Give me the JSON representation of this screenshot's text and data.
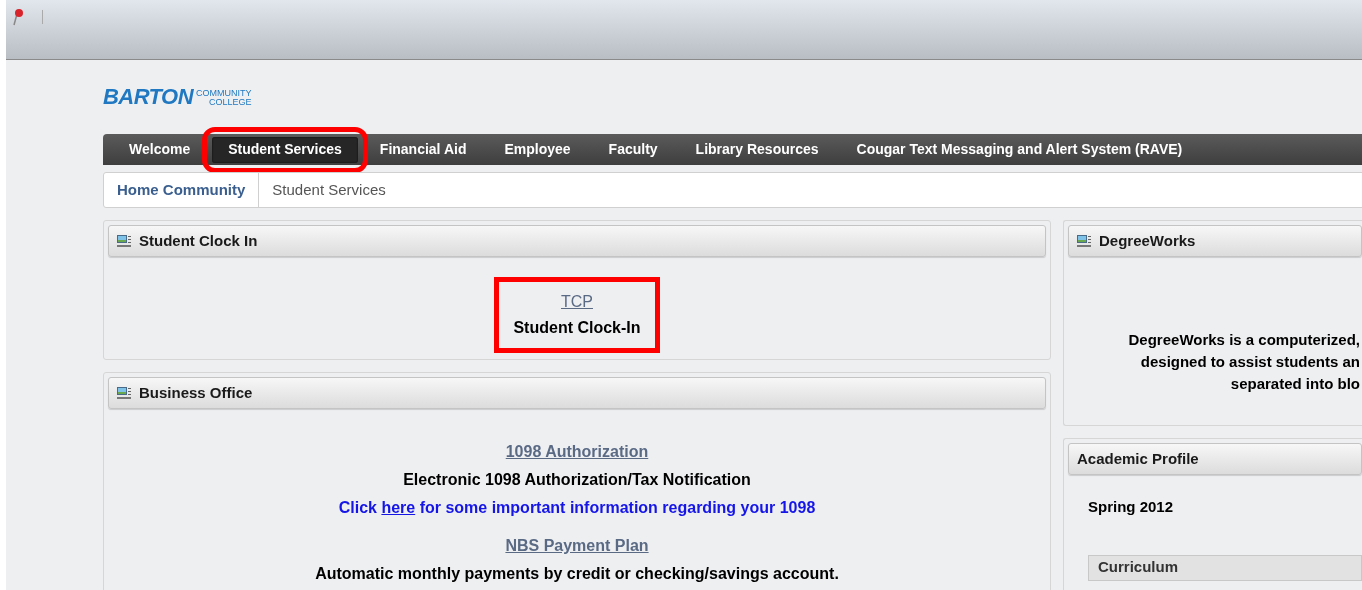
{
  "logo": {
    "name": "BARTON",
    "line_1": "COMMUNITY",
    "line_2": "COLLEGE"
  },
  "nav": [
    {
      "label": "Welcome",
      "selected": false,
      "highlighted": false
    },
    {
      "label": "Student Services",
      "selected": true,
      "highlighted": true
    },
    {
      "label": "Financial Aid",
      "selected": false,
      "highlighted": false
    },
    {
      "label": "Employee",
      "selected": false,
      "highlighted": false
    },
    {
      "label": "Faculty",
      "selected": false,
      "highlighted": false
    },
    {
      "label": "Library Resources",
      "selected": false,
      "highlighted": false
    },
    {
      "label": "Cougar Text Messaging and Alert System (RAVE)",
      "selected": false,
      "highlighted": false
    }
  ],
  "breadcrumb": [
    "Home Community",
    "Student Services"
  ],
  "student_clock_in": {
    "title": "Student Clock In",
    "link": "TCP",
    "caption": "Student Clock-In",
    "highlighted": true
  },
  "business_office": {
    "title": "Business Office",
    "items": [
      {
        "link": "1098 Authorization",
        "caption": "Electronic 1098 Authorization/Tax Notification",
        "note": {
          "before": "Click",
          "link": "here",
          "after": "for some important information regarding your 1098"
        }
      },
      {
        "link": "NBS Payment Plan",
        "caption": "Automatic monthly payments by credit or checking/savings account."
      }
    ]
  },
  "degreeworks": {
    "title": "DegreeWorks",
    "lines": [
      "DegreeWorks is a computerized,",
      "designed to assist students an",
      "separated into blo"
    ]
  },
  "academic_profile": {
    "title": "Academic Profile",
    "term": "Spring 2012",
    "table_header": "Curriculum"
  }
}
